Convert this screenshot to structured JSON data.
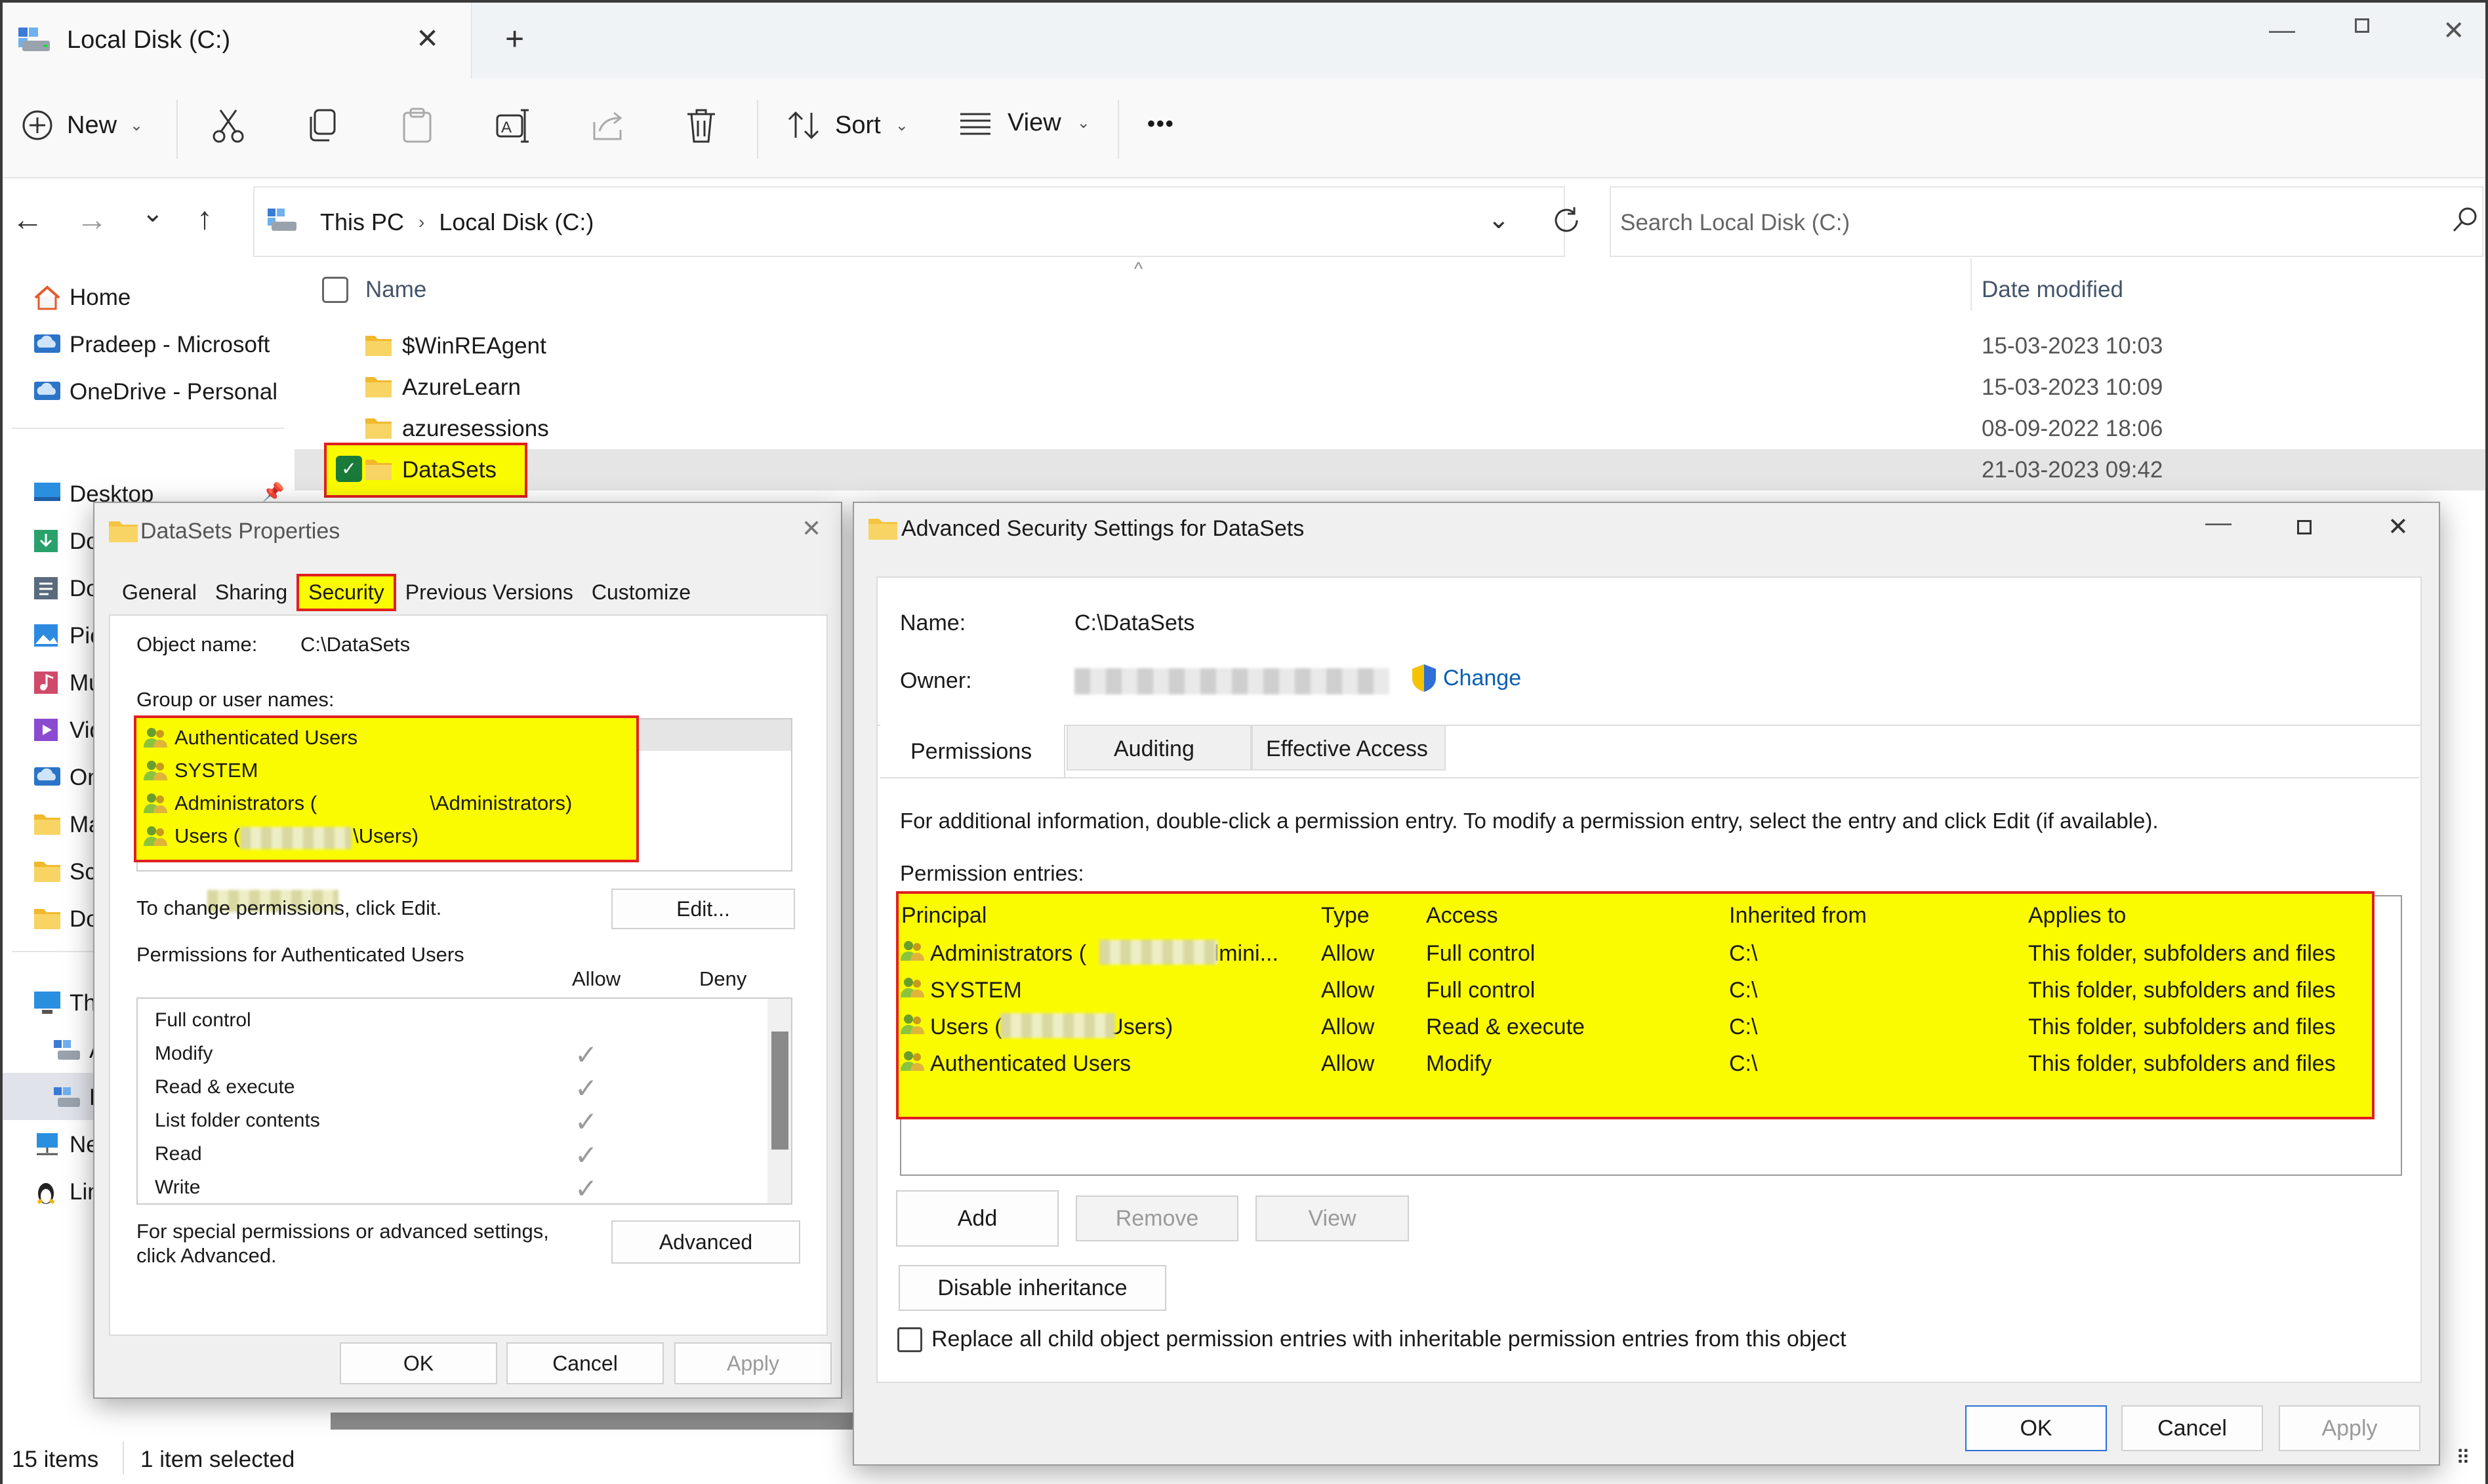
{
  "window": {
    "tab_title": "Local Disk (C:)",
    "new_tab_glyph": "+"
  },
  "toolbar": {
    "new_label": "New",
    "sort_label": "Sort",
    "view_label": "View",
    "more_glyph": "•••"
  },
  "address": {
    "crumbs": [
      "This PC",
      "Local Disk (C:)"
    ],
    "search_placeholder": "Search Local Disk (C:)"
  },
  "nav": {
    "items": [
      {
        "label": "Home"
      },
      {
        "label": "Pradeep - Microsoft"
      },
      {
        "label": "OneDrive - Personal"
      },
      {
        "label": "Desktop"
      },
      {
        "label": "Do"
      },
      {
        "label": "Do"
      },
      {
        "label": "Pic"
      },
      {
        "label": "Mu"
      },
      {
        "label": "Vid"
      },
      {
        "label": "On"
      },
      {
        "label": "Ma"
      },
      {
        "label": "Scr"
      },
      {
        "label": "Do"
      },
      {
        "label": "Th"
      },
      {
        "label": "A"
      },
      {
        "label": "L"
      },
      {
        "label": "Ne"
      },
      {
        "label": "Lin"
      }
    ]
  },
  "files": {
    "col_name": "Name",
    "col_date": "Date modified",
    "rows": [
      {
        "name": "$WinREAgent",
        "date": "15-03-2023 10:03"
      },
      {
        "name": "AzureLearn",
        "date": "15-03-2023 10:09"
      },
      {
        "name": "azuresessions",
        "date": "08-09-2022 18:06"
      },
      {
        "name": "DataSets",
        "date": "21-03-2023 09:42"
      }
    ]
  },
  "status": {
    "count": "15 items",
    "selected": "1 item selected"
  },
  "props": {
    "title": "DataSets Properties",
    "tabs": [
      "General",
      "Sharing",
      "Security",
      "Previous Versions",
      "Customize"
    ],
    "object_name_label": "Object name:",
    "object_name_value": "C:\\DataSets",
    "group_label": "Group or user names:",
    "groups": [
      "Authenticated Users",
      "SYSTEM",
      "Administrators (                    \\Administrators)",
      "Users (                    \\Users)"
    ],
    "change_text": "To change permissions, click Edit.",
    "edit_label": "Edit...",
    "perms_for_label": "Permissions for Authenticated Users",
    "allow_label": "Allow",
    "deny_label": "Deny",
    "perms": [
      "Full control",
      "Modify",
      "Read & execute",
      "List folder contents",
      "Read",
      "Write"
    ],
    "special_text": "For special permissions or advanced settings, click Advanced.",
    "advanced_label": "Advanced",
    "ok_label": "OK",
    "cancel_label": "Cancel",
    "apply_label": "Apply"
  },
  "adv": {
    "title": "Advanced Security Settings for DataSets",
    "name_label": "Name:",
    "name_value": "C:\\DataSets",
    "owner_label": "Owner:",
    "change_label": "Change",
    "tabs": [
      "Permissions",
      "Auditing",
      "Effective Access"
    ],
    "info_text": "For additional information, double-click a permission entry. To modify a permission entry, select the entry and click Edit (if available).",
    "entries_label": "Permission entries:",
    "columns": [
      "Principal",
      "Type",
      "Access",
      "Inherited from",
      "Applies to"
    ],
    "entries": [
      {
        "principal": "Administrators (                \\Admini...",
        "type": "Allow",
        "access": "Full control",
        "inherited": "C:\\",
        "applies": "This folder, subfolders and files"
      },
      {
        "principal": "SYSTEM",
        "type": "Allow",
        "access": "Full control",
        "inherited": "C:\\",
        "applies": "This folder, subfolders and files"
      },
      {
        "principal": "Users (                \\Users)",
        "type": "Allow",
        "access": "Read & execute",
        "inherited": "C:\\",
        "applies": "This folder, subfolders and files"
      },
      {
        "principal": "Authenticated Users",
        "type": "Allow",
        "access": "Modify",
        "inherited": "C:\\",
        "applies": "This folder, subfolders and files"
      }
    ],
    "add_label": "Add",
    "remove_label": "Remove",
    "view_label": "View",
    "disable_label": "Disable inheritance",
    "replace_label": "Replace all child object permission entries with inheritable permission entries from this object",
    "ok_label": "OK",
    "cancel_label": "Cancel",
    "apply_label": "Apply"
  },
  "colors": {
    "highlight": "#fbfb00",
    "highlight_border": "#e02020",
    "accent": "#0a5fb4",
    "folder": "#f4c542"
  }
}
